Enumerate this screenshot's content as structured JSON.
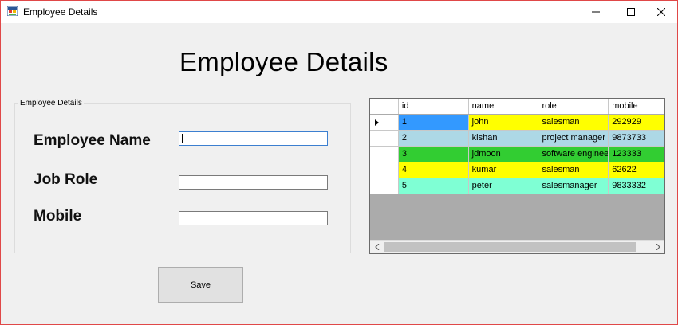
{
  "window": {
    "title": "Employee Details"
  },
  "heading": "Employee Details",
  "form": {
    "group_title": "Employee Details",
    "name_label": "Employee Name",
    "role_label": "Job Role",
    "mobile_label": "Mobile",
    "name_value": "",
    "role_value": "",
    "mobile_value": "",
    "save_label": "Save"
  },
  "grid": {
    "columns": [
      "id",
      "name",
      "role",
      "mobile"
    ],
    "rows": [
      {
        "id": "1",
        "name": "john",
        "role": "salesman",
        "mobile": "292929",
        "colors": [
          "#3399ff",
          "#ffff00",
          "#ffff00",
          "#ffff00"
        ]
      },
      {
        "id": "2",
        "name": "kishan",
        "role": "project manager",
        "mobile": "9873733",
        "colors": [
          "#add8e6",
          "#add8e6",
          "#add8e6",
          "#add8e6"
        ]
      },
      {
        "id": "3",
        "name": "jdmoon",
        "role": "software engineer",
        "mobile": "123333",
        "colors": [
          "#32cd32",
          "#32cd32",
          "#32cd32",
          "#32cd32"
        ]
      },
      {
        "id": "4",
        "name": "kumar",
        "role": "salesman",
        "mobile": "62622",
        "colors": [
          "#ffff00",
          "#ffff00",
          "#ffff00",
          "#ffff00"
        ]
      },
      {
        "id": "5",
        "name": "peter",
        "role": "salesmanager",
        "mobile": "9833332",
        "colors": [
          "#7fffd4",
          "#7fffd4",
          "#7fffd4",
          "#7fffd4"
        ]
      }
    ]
  },
  "colors": {
    "window_border": "#e04848",
    "background": "#f0f0f0",
    "grid_empty": "#ababab"
  }
}
